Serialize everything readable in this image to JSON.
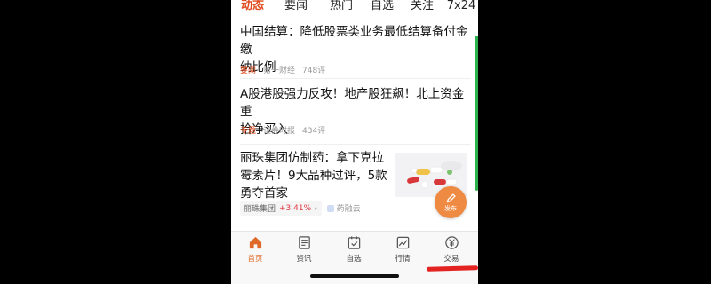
{
  "tabs": [
    {
      "label": "动态",
      "active": true
    },
    {
      "label": "要闻",
      "active": false
    },
    {
      "label": "热门",
      "active": false
    },
    {
      "label": "自选",
      "active": false
    },
    {
      "label": "关注",
      "active": false
    },
    {
      "label": "7x24",
      "active": false
    }
  ],
  "news": [
    {
      "title": "中国结算：降低股票类业务最低结算备付金缴\n纳比例",
      "tag": "要闻",
      "source": "第一财经",
      "comments": "748评"
    },
    {
      "title": "A股港股强力反攻！地产股狂飙！北上资金重\n拾净买入",
      "tag": "专题",
      "source": "证券时报",
      "comments": "434评"
    },
    {
      "title": "丽珠集团仿制药：拿下克拉\n霉素片！9大品种过评，5款\n勇夺首家",
      "stock_name": "丽珠集团",
      "stock_change": "+3.41%",
      "source": "药融云",
      "thumb_icon": "pill-image"
    }
  ],
  "fab": {
    "label": "发布",
    "icon": "pencil-icon"
  },
  "bottom_nav": [
    {
      "label": "首页",
      "icon": "home-icon",
      "active": true
    },
    {
      "label": "资讯",
      "icon": "news-icon",
      "active": false
    },
    {
      "label": "自选",
      "icon": "watchlist-icon",
      "active": false
    },
    {
      "label": "行情",
      "icon": "chart-icon",
      "active": false
    },
    {
      "label": "交易",
      "icon": "yuan-icon",
      "active": false
    }
  ],
  "colors": {
    "accent": "#e04c1f",
    "fab": "#ef8a43",
    "rise": "#e0333e",
    "annotation": "#e32322",
    "scroll": "#2bb24c"
  }
}
